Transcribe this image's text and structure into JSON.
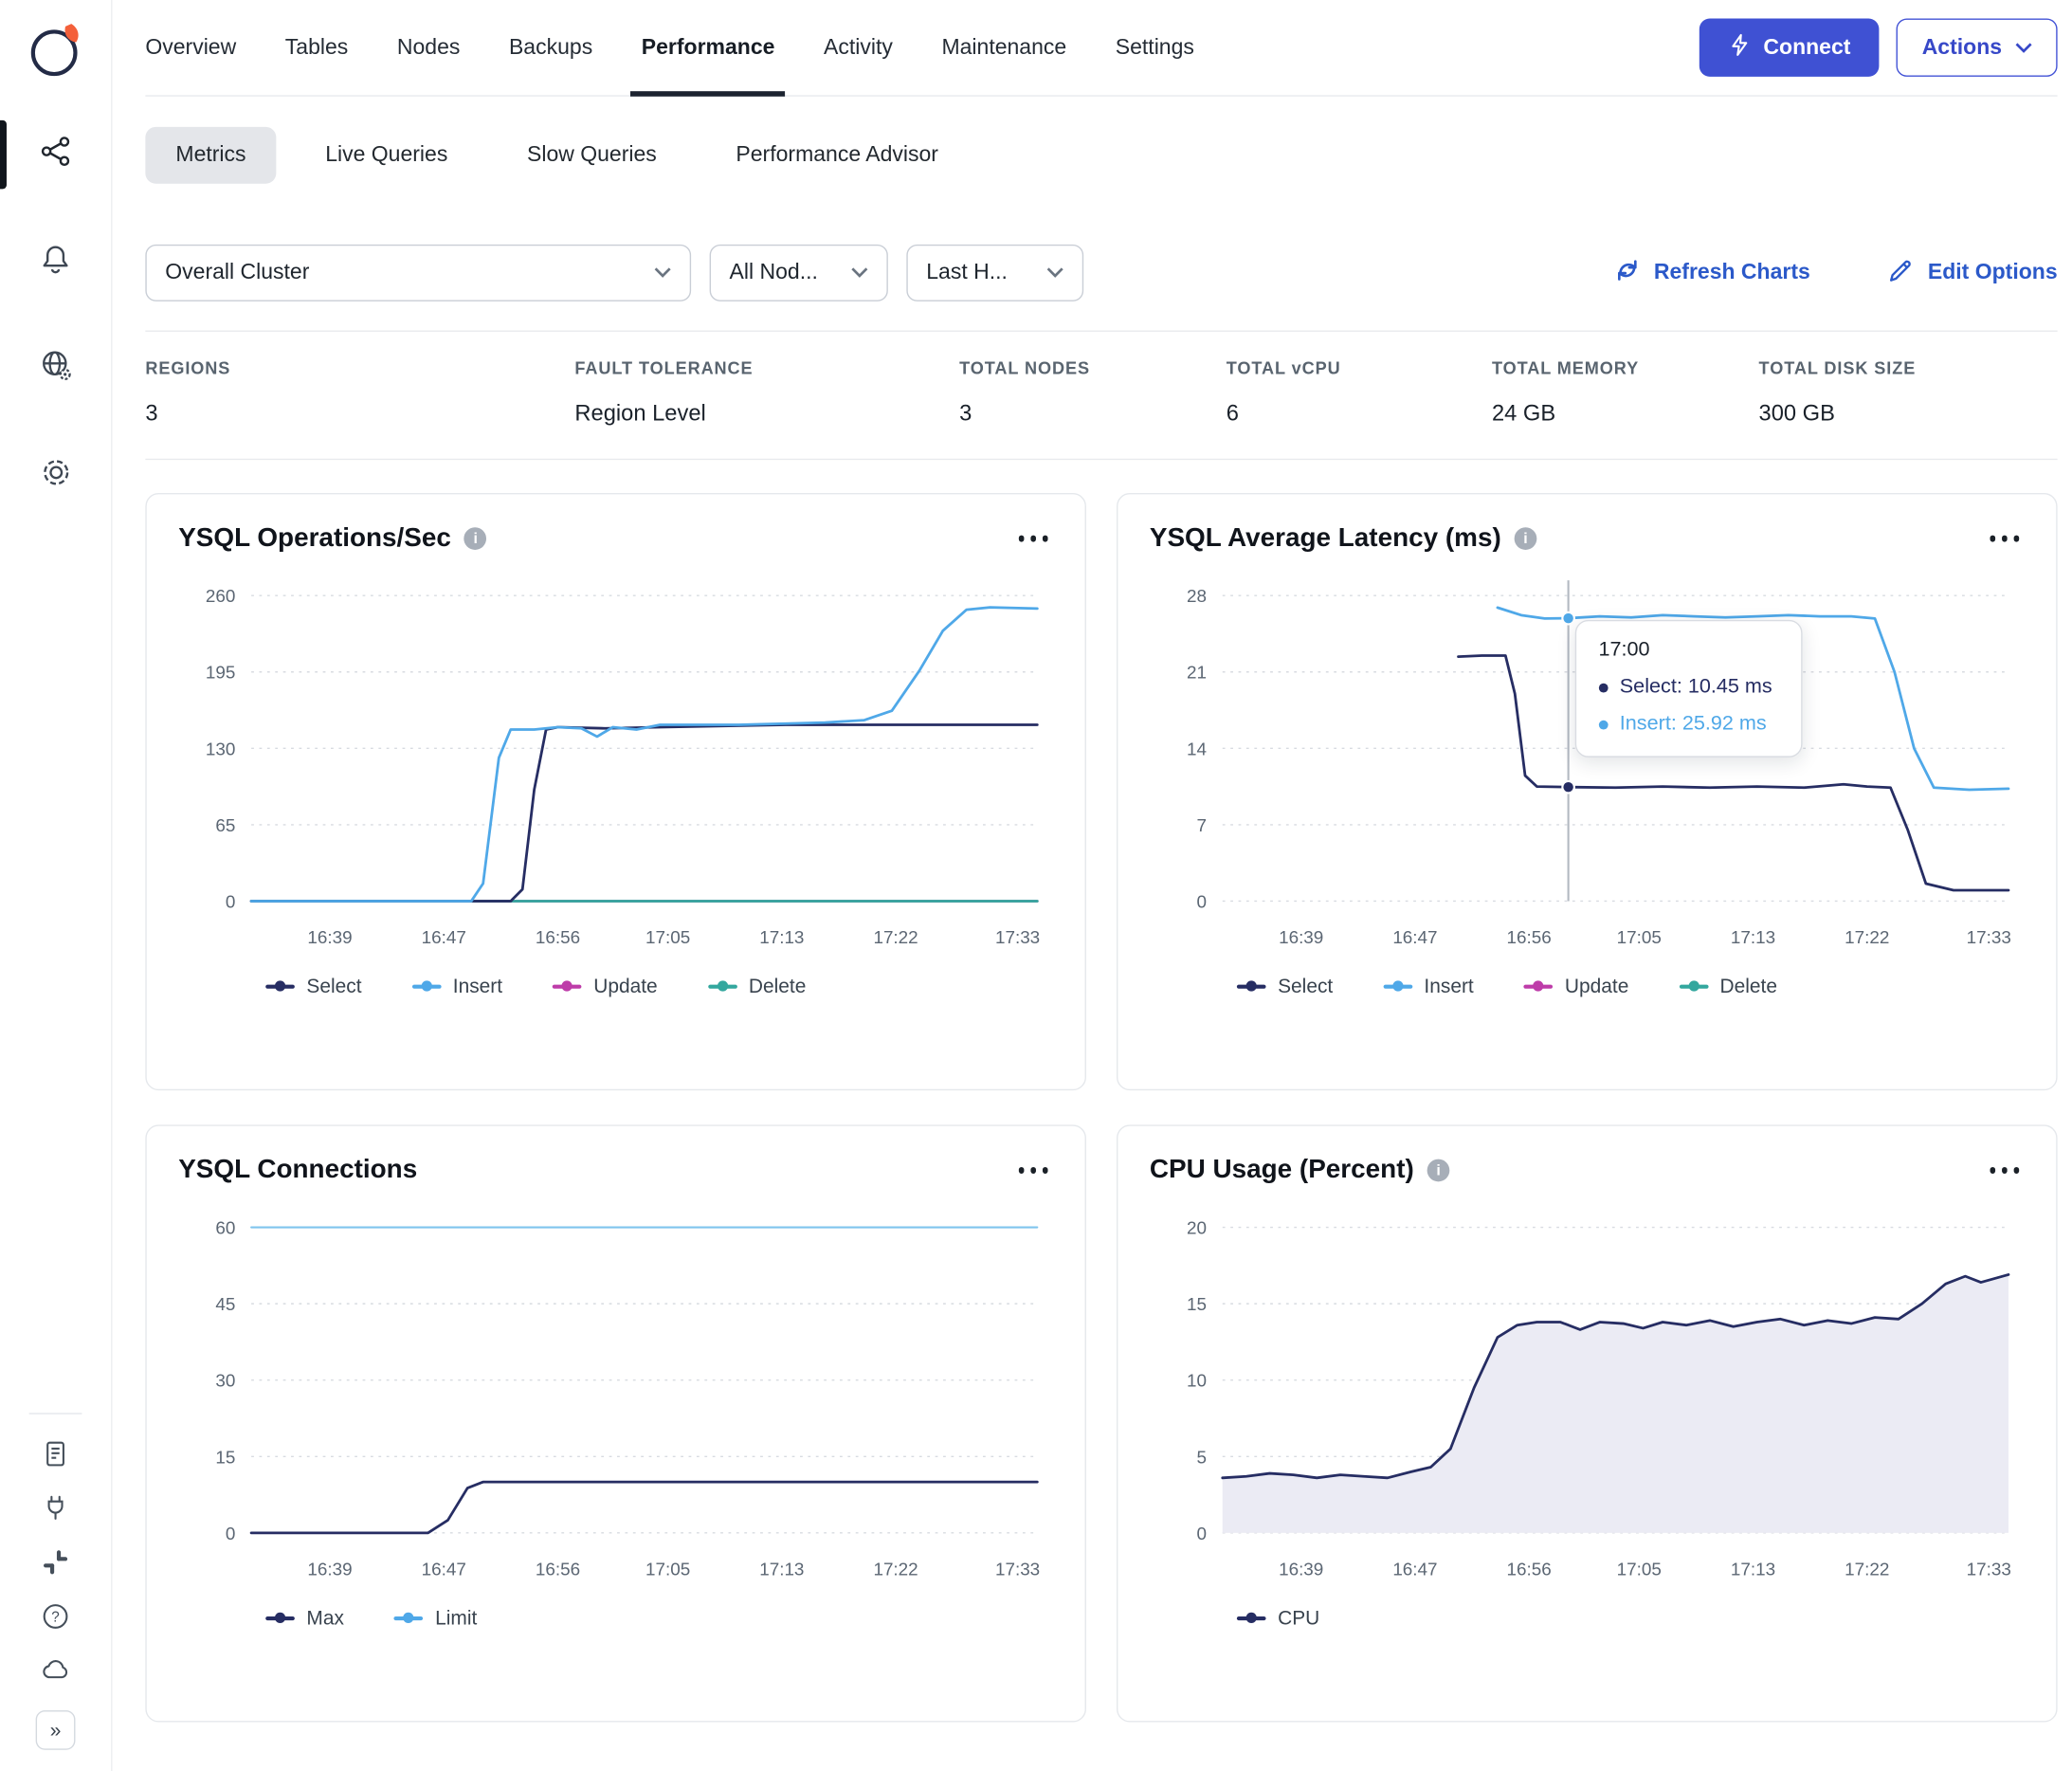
{
  "colors": {
    "link_blue": "#2B59C9",
    "button_indigo": "#3F51D3",
    "series_navy": "#262D63",
    "series_blue": "#4FA8E8",
    "series_magenta": "#BE3CA9",
    "series_teal": "#33A79E",
    "cpu_fill": "#EBEBF4",
    "active_underline": "#1C2330"
  },
  "icons": {
    "logo": "yugabyte-planet-logo",
    "clusters": "cluster-network-icon",
    "alerts": "bell-icon",
    "regions": "globe-gear-icon",
    "settings": "gear-icon",
    "docs": "document-icon",
    "integrations": "plug-icon",
    "slack": "slack-icon",
    "help": "question-circle-icon",
    "cloud": "cloud-icon",
    "expand": "double-chevron-right-icon",
    "connect": "lightning-bolt-icon",
    "refresh": "refresh-icon",
    "edit": "pencil-icon",
    "card_menu": "ellipsis-icon",
    "info": "info-icon",
    "dropdown": "chevron-down-icon"
  },
  "topnav": {
    "tabs": [
      "Overview",
      "Tables",
      "Nodes",
      "Backups",
      "Performance",
      "Activity",
      "Maintenance",
      "Settings"
    ],
    "active": "Performance",
    "connect_label": "Connect",
    "actions_label": "Actions"
  },
  "subtabs": {
    "items": [
      "Metrics",
      "Live Queries",
      "Slow Queries",
      "Performance Advisor"
    ],
    "active": "Metrics"
  },
  "filters": {
    "cluster_value": "Overall Cluster",
    "nodes_value": "All Nod...",
    "range_value": "Last H...",
    "refresh_label": "Refresh Charts",
    "edit_label": "Edit Options"
  },
  "stats": [
    {
      "label": "REGIONS",
      "value": "3"
    },
    {
      "label": "FAULT TOLERANCE",
      "value": "Region Level"
    },
    {
      "label": "TOTAL NODES",
      "value": "3"
    },
    {
      "label": "TOTAL vCPU",
      "value": "6"
    },
    {
      "label": "TOTAL MEMORY",
      "value": "24 GB"
    },
    {
      "label": "TOTAL DISK SIZE",
      "value": "300 GB"
    }
  ],
  "chart_data": [
    {
      "type": "line",
      "title": "YSQL Operations/Sec",
      "info_icon": true,
      "x_ticks": [
        "16:39",
        "16:47",
        "16:56",
        "17:05",
        "17:13",
        "17:22",
        "17:33"
      ],
      "x_tick_pos": [
        0.1,
        0.245,
        0.39,
        0.53,
        0.675,
        0.82,
        0.975
      ],
      "y_ticks": [
        0,
        65,
        130,
        195,
        260
      ],
      "ylim": [
        0,
        273
      ],
      "legend_position": "bottom",
      "grid": true,
      "legend": [
        {
          "name": "Select",
          "color": "#262D63"
        },
        {
          "name": "Insert",
          "color": "#4FA8E8"
        },
        {
          "name": "Update",
          "color": "#BE3CA9"
        },
        {
          "name": "Delete",
          "color": "#33A79E"
        }
      ],
      "series": [
        {
          "name": "Update",
          "color": "#BE3CA9",
          "points": [
            [
              0,
              0
            ],
            [
              1,
              0
            ]
          ]
        },
        {
          "name": "Delete",
          "color": "#33A79E",
          "points": [
            [
              0,
              0
            ],
            [
              1,
              0
            ]
          ]
        },
        {
          "name": "Select",
          "color": "#262D63",
          "points": [
            [
              0,
              0
            ],
            [
              0.33,
              0
            ],
            [
              0.345,
              10
            ],
            [
              0.36,
              95
            ],
            [
              0.375,
              146
            ],
            [
              0.39,
              148
            ],
            [
              0.45,
              147
            ],
            [
              0.52,
              148
            ],
            [
              0.6,
              149
            ],
            [
              0.68,
              150
            ],
            [
              0.76,
              150
            ],
            [
              0.85,
              150
            ],
            [
              1,
              150
            ]
          ]
        },
        {
          "name": "Insert",
          "color": "#4FA8E8",
          "points": [
            [
              0,
              0
            ],
            [
              0.28,
              0
            ],
            [
              0.295,
              15
            ],
            [
              0.315,
              122
            ],
            [
              0.33,
              146
            ],
            [
              0.36,
              146
            ],
            [
              0.39,
              148
            ],
            [
              0.42,
              147
            ],
            [
              0.44,
              140
            ],
            [
              0.46,
              148
            ],
            [
              0.49,
              146
            ],
            [
              0.52,
              150
            ],
            [
              0.56,
              150
            ],
            [
              0.62,
              150
            ],
            [
              0.68,
              151
            ],
            [
              0.73,
              152
            ],
            [
              0.78,
              154
            ],
            [
              0.815,
              162
            ],
            [
              0.85,
              196
            ],
            [
              0.88,
              230
            ],
            [
              0.91,
              248
            ],
            [
              0.94,
              250
            ],
            [
              1,
              249
            ]
          ]
        }
      ]
    },
    {
      "type": "line",
      "title": "YSQL Average Latency (ms)",
      "info_icon": true,
      "x_ticks": [
        "16:39",
        "16:47",
        "16:56",
        "17:05",
        "17:13",
        "17:22",
        "17:33"
      ],
      "x_tick_pos": [
        0.1,
        0.245,
        0.39,
        0.53,
        0.675,
        0.82,
        0.975
      ],
      "y_ticks": [
        0,
        7,
        14,
        21,
        28
      ],
      "ylim": [
        0,
        29.4
      ],
      "legend_position": "bottom",
      "grid": true,
      "legend": [
        {
          "name": "Select",
          "color": "#262D63"
        },
        {
          "name": "Insert",
          "color": "#4FA8E8"
        },
        {
          "name": "Update",
          "color": "#BE3CA9"
        },
        {
          "name": "Delete",
          "color": "#33A79E"
        }
      ],
      "series": [
        {
          "name": "Select",
          "color": "#262D63",
          "points": [
            [
              0.3,
              22.4
            ],
            [
              0.33,
              22.5
            ],
            [
              0.36,
              22.5
            ],
            [
              0.372,
              19
            ],
            [
              0.385,
              11.5
            ],
            [
              0.4,
              10.5
            ],
            [
              0.44,
              10.45
            ],
            [
              0.5,
              10.4
            ],
            [
              0.56,
              10.5
            ],
            [
              0.62,
              10.4
            ],
            [
              0.68,
              10.5
            ],
            [
              0.74,
              10.4
            ],
            [
              0.79,
              10.7
            ],
            [
              0.82,
              10.5
            ],
            [
              0.85,
              10.4
            ],
            [
              0.872,
              6.5
            ],
            [
              0.895,
              1.6
            ],
            [
              0.93,
              1.0
            ],
            [
              1,
              1.0
            ]
          ]
        },
        {
          "name": "Insert",
          "color": "#4FA8E8",
          "points": [
            [
              0.35,
              26.9
            ],
            [
              0.38,
              26.2
            ],
            [
              0.41,
              25.9
            ],
            [
              0.44,
              25.92
            ],
            [
              0.48,
              26.1
            ],
            [
              0.52,
              26.0
            ],
            [
              0.56,
              26.2
            ],
            [
              0.6,
              26.1
            ],
            [
              0.64,
              26.0
            ],
            [
              0.68,
              26.1
            ],
            [
              0.72,
              26.2
            ],
            [
              0.76,
              26.1
            ],
            [
              0.8,
              26.1
            ],
            [
              0.83,
              25.9
            ],
            [
              0.855,
              21
            ],
            [
              0.88,
              14
            ],
            [
              0.905,
              10.4
            ],
            [
              0.95,
              10.2
            ],
            [
              1,
              10.3
            ]
          ]
        }
      ],
      "crosshair": {
        "t": 0.44,
        "color": "#B3B9C2",
        "points": [
          {
            "v": 25.92,
            "color": "#4FA8E8"
          },
          {
            "v": 10.45,
            "color": "#262D63"
          }
        ]
      },
      "tooltip": {
        "time": "17:00",
        "rows": [
          {
            "text": "Select: 10.45 ms",
            "color": "#262D63"
          },
          {
            "text": "Insert: 25.92 ms",
            "color": "#4FA8E8"
          }
        ]
      }
    },
    {
      "type": "line",
      "title": "YSQL Connections",
      "info_icon": false,
      "x_ticks": [
        "16:39",
        "16:47",
        "16:56",
        "17:05",
        "17:13",
        "17:22",
        "17:33"
      ],
      "x_tick_pos": [
        0.1,
        0.245,
        0.39,
        0.53,
        0.675,
        0.82,
        0.975
      ],
      "y_ticks": [
        0,
        15,
        30,
        45,
        60
      ],
      "ylim": [
        0,
        63
      ],
      "legend_position": "bottom",
      "grid": true,
      "legend": [
        {
          "name": "Max",
          "color": "#262D63"
        },
        {
          "name": "Limit",
          "color": "#4FA8E8"
        }
      ],
      "series": [
        {
          "name": "Limit",
          "color": "#7FC4EE",
          "width": 1.5,
          "points": [
            [
              0,
              60
            ],
            [
              1,
              60
            ]
          ]
        },
        {
          "name": "Max",
          "color": "#262D63",
          "points": [
            [
              0,
              0
            ],
            [
              0.225,
              0
            ],
            [
              0.25,
              2.5
            ],
            [
              0.275,
              8.8
            ],
            [
              0.295,
              10
            ],
            [
              1,
              10
            ]
          ]
        }
      ]
    },
    {
      "type": "area",
      "title": "CPU Usage (Percent)",
      "info_icon": true,
      "x_ticks": [
        "16:39",
        "16:47",
        "16:56",
        "17:05",
        "17:13",
        "17:22",
        "17:33"
      ],
      "x_tick_pos": [
        0.1,
        0.245,
        0.39,
        0.53,
        0.675,
        0.82,
        0.975
      ],
      "y_ticks": [
        0,
        5,
        10,
        15,
        20
      ],
      "ylim": [
        0,
        21
      ],
      "legend_position": "bottom",
      "grid": true,
      "legend": [
        {
          "name": "CPU",
          "color": "#262D63"
        }
      ],
      "series": [
        {
          "name": "CPU",
          "color": "#262D63",
          "fill": "#EBEBF4",
          "points": [
            [
              0,
              3.6
            ],
            [
              0.03,
              3.7
            ],
            [
              0.06,
              3.9
            ],
            [
              0.09,
              3.8
            ],
            [
              0.12,
              3.6
            ],
            [
              0.15,
              3.8
            ],
            [
              0.18,
              3.7
            ],
            [
              0.21,
              3.6
            ],
            [
              0.24,
              4.0
            ],
            [
              0.265,
              4.3
            ],
            [
              0.29,
              5.5
            ],
            [
              0.32,
              9.5
            ],
            [
              0.35,
              12.8
            ],
            [
              0.375,
              13.6
            ],
            [
              0.4,
              13.8
            ],
            [
              0.43,
              13.8
            ],
            [
              0.455,
              13.3
            ],
            [
              0.48,
              13.8
            ],
            [
              0.51,
              13.7
            ],
            [
              0.535,
              13.4
            ],
            [
              0.56,
              13.8
            ],
            [
              0.59,
              13.6
            ],
            [
              0.62,
              13.9
            ],
            [
              0.65,
              13.5
            ],
            [
              0.68,
              13.8
            ],
            [
              0.71,
              14.0
            ],
            [
              0.74,
              13.6
            ],
            [
              0.77,
              13.9
            ],
            [
              0.8,
              13.7
            ],
            [
              0.83,
              14.1
            ],
            [
              0.86,
              14.0
            ],
            [
              0.89,
              15.0
            ],
            [
              0.92,
              16.3
            ],
            [
              0.945,
              16.8
            ],
            [
              0.965,
              16.4
            ],
            [
              1,
              16.9
            ]
          ]
        }
      ]
    }
  ]
}
